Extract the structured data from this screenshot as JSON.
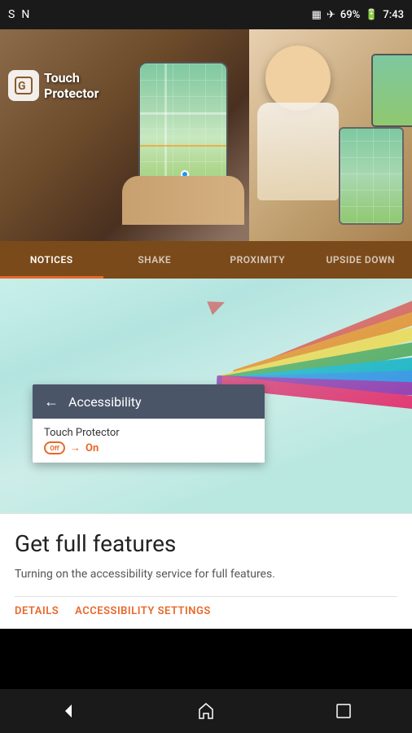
{
  "statusBar": {
    "leftIcons": [
      "S",
      "N"
    ],
    "vibrate": "▦",
    "airplane": "✈",
    "battery": "69%",
    "time": "7:43"
  },
  "appLogo": {
    "iconText": "G",
    "line1": "Touch",
    "line2": "Protector"
  },
  "tabs": [
    {
      "id": "notices",
      "label": "NOTICES",
      "active": true
    },
    {
      "id": "shake",
      "label": "SHAKE",
      "active": false
    },
    {
      "id": "proximity",
      "label": "PROXIMITY",
      "active": false
    },
    {
      "id": "upsidedown",
      "label": "UPSIDE DOWN",
      "active": false
    }
  ],
  "accessibilityCard": {
    "backArrow": "←",
    "title": "Accessibility",
    "appName": "Touch Protector",
    "offLabel": "Off",
    "arrowLabel": "→",
    "onLabel": "On"
  },
  "featuresSection": {
    "title": "Get full features",
    "description": "Turning on the accessibility service for full features.",
    "links": [
      {
        "id": "details",
        "label": "DETAILS"
      },
      {
        "id": "accessibility-settings",
        "label": "ACCESSIBILITY SETTINGS"
      }
    ]
  },
  "bottomNav": {
    "back": "back-button",
    "home": "home-button",
    "recent": "recent-button"
  }
}
